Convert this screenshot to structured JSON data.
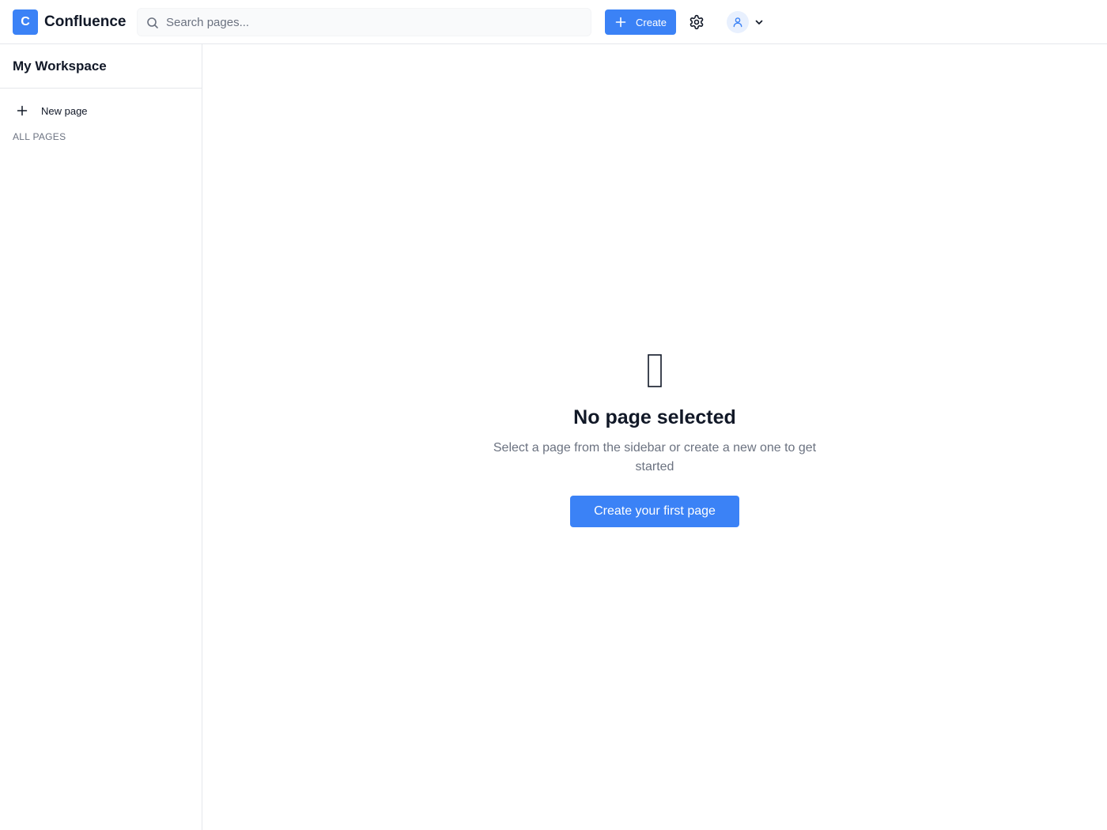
{
  "header": {
    "logo_letter": "C",
    "app_title": "Confluence",
    "search_placeholder": "Search pages...",
    "create_label": "Create",
    "icons": [
      "search-icon",
      "plus-icon",
      "gear-icon",
      "user-icon",
      "chevron-down-icon"
    ]
  },
  "sidebar": {
    "workspace_title": "My Workspace",
    "new_page_label": "New page",
    "section_label": "ALL PAGES"
  },
  "main": {
    "empty_icon": "document-icon",
    "title": "No page selected",
    "subtitle": "Select a page from the sidebar or create a new one to get started",
    "cta_label": "Create your first page"
  },
  "colors": {
    "accent": "#3b82f6",
    "border": "#e5e7eb",
    "muted_text": "#6b7280",
    "text": "#111827"
  }
}
